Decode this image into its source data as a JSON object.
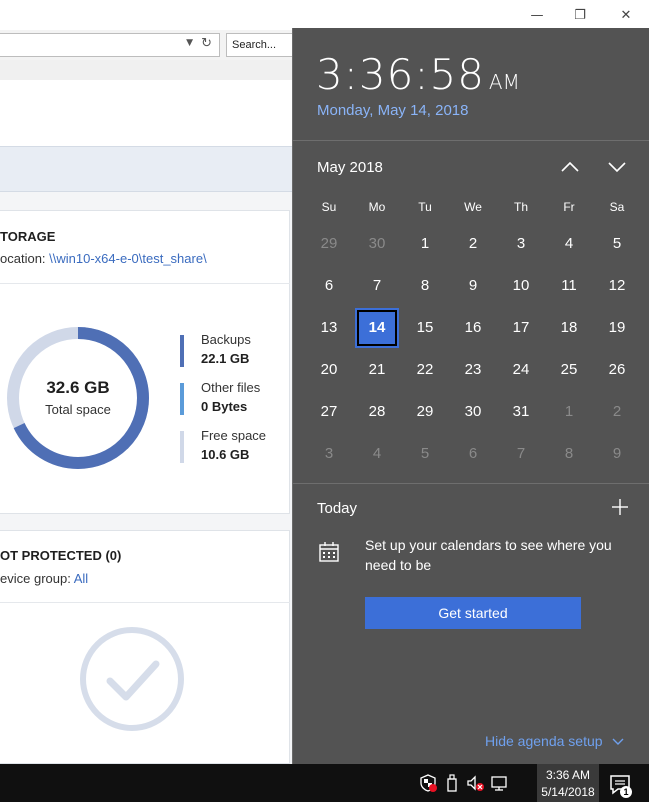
{
  "browser": {
    "search_placeholder": "Search...",
    "window_controls": {
      "minimize": "—",
      "restore": "❐",
      "close": "✕"
    }
  },
  "storage_card": {
    "title": "TORAGE",
    "location_prefix": "ocation: ",
    "location_path": "\\\\win10-x64-e-0\\test_share\\",
    "total_value": "32.6 GB",
    "total_label": "Total space",
    "used_fraction": 0.68,
    "legend": [
      {
        "name": "Backups",
        "value": "22.1 GB",
        "color": "#4f6fb5"
      },
      {
        "name": "Other files",
        "value": "0 Bytes",
        "color": "#5b9bd9"
      },
      {
        "name": "Free space",
        "value": "10.6 GB",
        "color": "#d0d8e8"
      }
    ]
  },
  "not_protected_card": {
    "title": "OT PROTECTED (0)",
    "device_group_prefix": "evice group: ",
    "device_group_value": "All",
    "icon": "checkmark-circle-icon"
  },
  "flyout": {
    "time": "3:36:58",
    "ampm": "AM",
    "long_date": "Monday, May 14, 2018",
    "month_label": "May 2018",
    "weekdays": [
      "Su",
      "Mo",
      "Tu",
      "We",
      "Th",
      "Fr",
      "Sa"
    ],
    "weeks": [
      [
        "29",
        "30",
        "1",
        "2",
        "3",
        "4",
        "5"
      ],
      [
        "6",
        "7",
        "8",
        "9",
        "10",
        "11",
        "12"
      ],
      [
        "13",
        "14",
        "15",
        "16",
        "17",
        "18",
        "19"
      ],
      [
        "20",
        "21",
        "22",
        "23",
        "24",
        "25",
        "26"
      ],
      [
        "27",
        "28",
        "29",
        "30",
        "31",
        "1",
        "2"
      ],
      [
        "3",
        "4",
        "5",
        "6",
        "7",
        "8",
        "9"
      ]
    ],
    "today_label": "Today",
    "setup_message": "Set up your calendars to see where you need to be",
    "get_started_label": "Get started",
    "hide_agenda_label": "Hide agenda setup",
    "accent_color": "#3c6fd8"
  },
  "taskbar": {
    "time": "3:36 AM",
    "date": "5/14/2018",
    "notification_count": "1",
    "tray_icons": [
      "shield-alert-icon",
      "usb-drive-icon",
      "volume-muted-icon",
      "network-icon"
    ]
  }
}
